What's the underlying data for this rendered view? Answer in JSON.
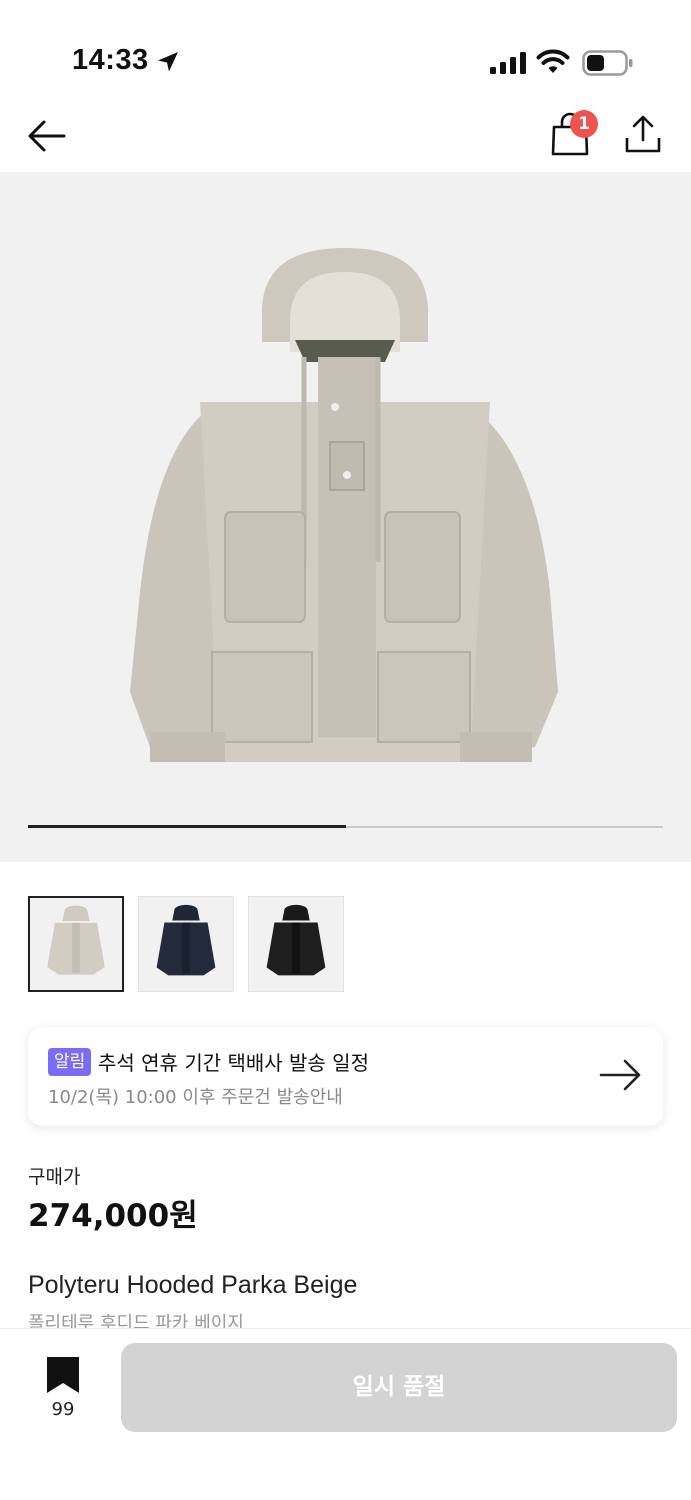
{
  "status_bar": {
    "time": "14:33"
  },
  "nav": {
    "cart_count": "1"
  },
  "gallery": {
    "progress": 0.5,
    "thumbnail_count": 3
  },
  "notice": {
    "tag": "알림",
    "title": "추석 연휴 기간 택배사 발송 일정",
    "subtitle": "10/2(목) 10:00 이후 주문건 발송안내"
  },
  "price": {
    "label": "구매가",
    "value": "274,000원"
  },
  "product": {
    "name": "Polyteru Hooded Parka Beige",
    "name_kr": "폴리테루 후디드 파카 베이지"
  },
  "bottom": {
    "bookmark_count": "99",
    "button_label": "일시 품절"
  },
  "colors": {
    "accent": "#7b6cf6",
    "badge": "#ef5350",
    "disabled": "#d3d3d3"
  }
}
